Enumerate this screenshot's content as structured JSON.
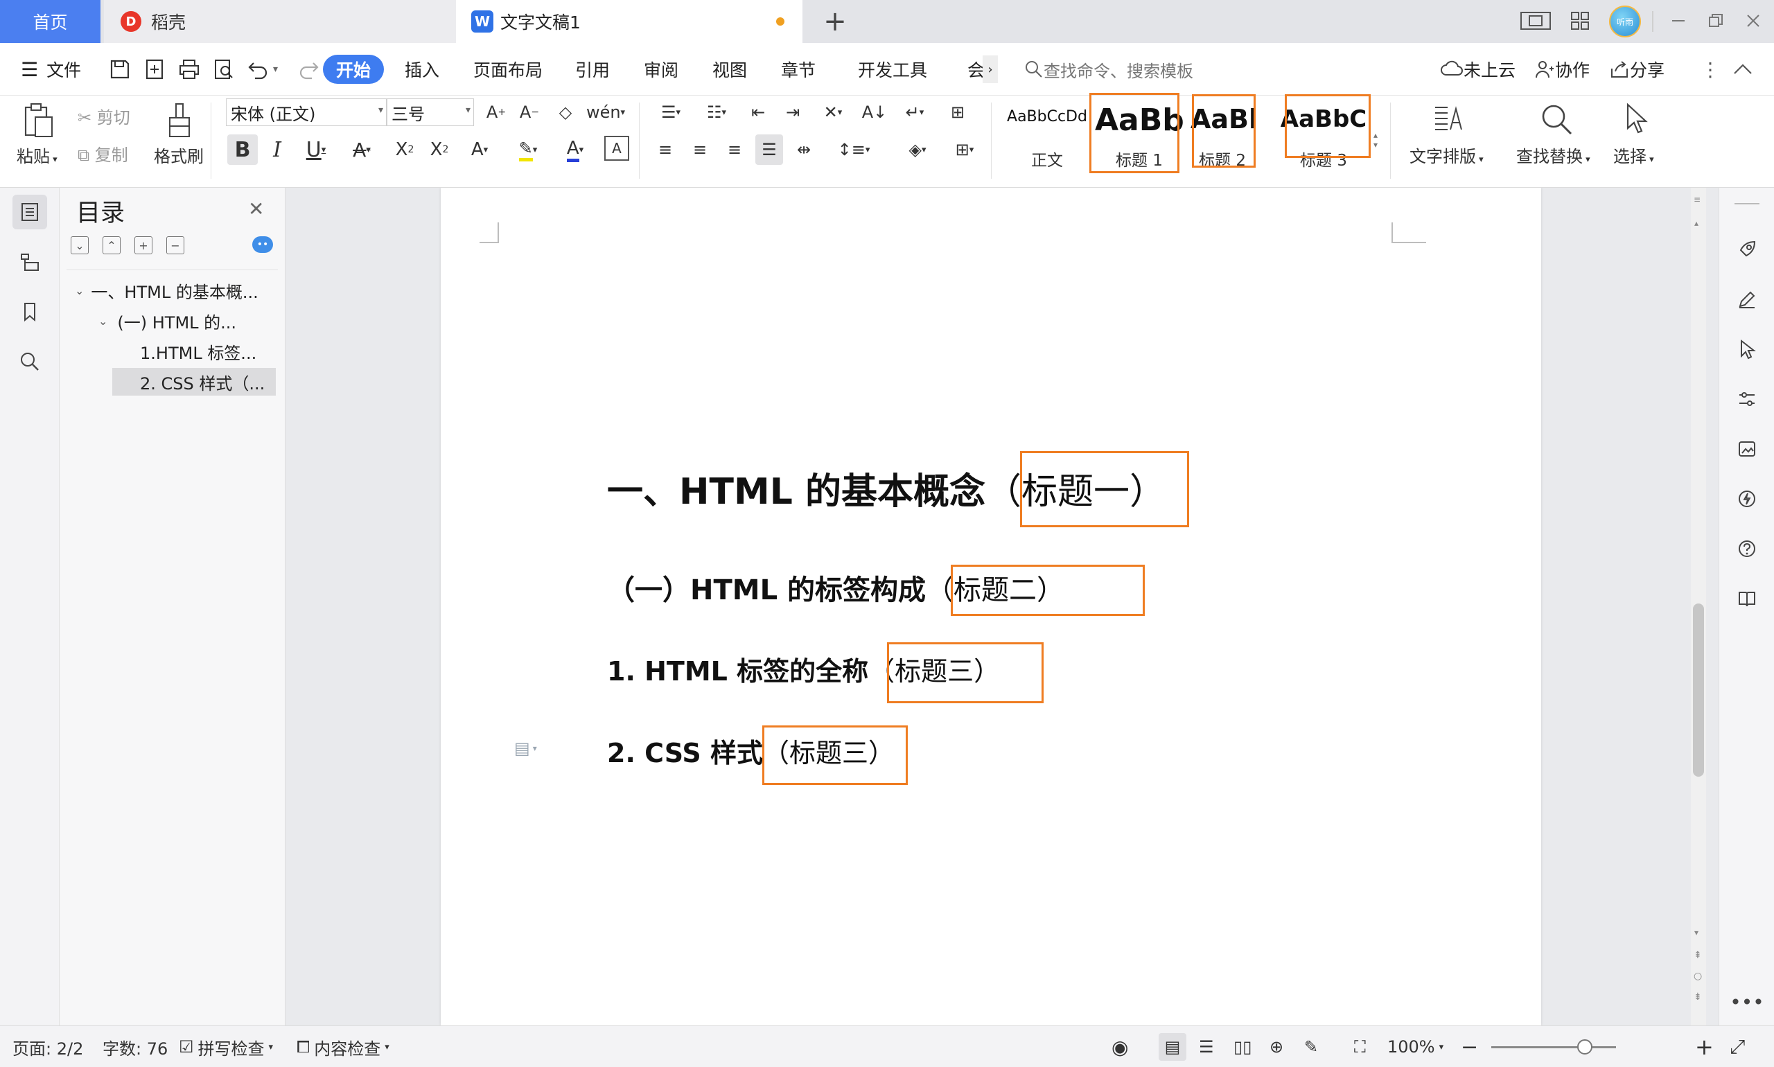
{
  "tabs": {
    "home": "首页",
    "daoke": "稻壳",
    "document": "文字文稿1",
    "add": "+"
  },
  "window": {
    "avatar_text": "听雨"
  },
  "menu": {
    "file": "文件",
    "items": [
      "开始",
      "插入",
      "页面布局",
      "引用",
      "审阅",
      "视图",
      "章节",
      "开发工具",
      "会"
    ],
    "search_placeholder": "查找命令、搜索模板",
    "cloud": "未上云",
    "collab": "协作",
    "share": "分享"
  },
  "ribbon": {
    "paste": "粘贴",
    "cut": "剪切",
    "copy": "复制",
    "format_painter": "格式刷",
    "font_name": "宋体 (正文)",
    "font_size": "三号",
    "styles": [
      {
        "sample": "AaBbCcDd",
        "name": "正文"
      },
      {
        "sample": "AaBb",
        "name": "标题 1"
      },
      {
        "sample": "AaBbC",
        "name": "标题 2"
      },
      {
        "sample": "AaBbC",
        "name": "标题 3"
      }
    ],
    "text_layout": "文字排版",
    "find_replace": "查找替换",
    "select": "选择"
  },
  "toc": {
    "title": "目录",
    "items": [
      "一、HTML 的基本概...",
      "(一) HTML 的...",
      "1.HTML 标签...",
      "2. CSS 样式（..."
    ]
  },
  "document": {
    "h1_text": "一、HTML 的基本概念",
    "h1_tag": "（标题一）",
    "h2_text": "（一）HTML 的标签构成",
    "h2_tag": "（标题二）",
    "h3a_text": "1.  HTML 标签的全称",
    "h3a_tag": "（标题三）",
    "h3b_text": "2. CSS 样式",
    "h3b_tag": "（标题三）"
  },
  "status": {
    "page": "页面: 2/2",
    "words": "字数: 76",
    "spell": "拼写检查",
    "content": "内容检查",
    "zoom": "100%"
  },
  "colors": {
    "accent": "#3e7cf0",
    "home_tab": "#4b7ff0",
    "highlight_box": "#ef7d22"
  }
}
